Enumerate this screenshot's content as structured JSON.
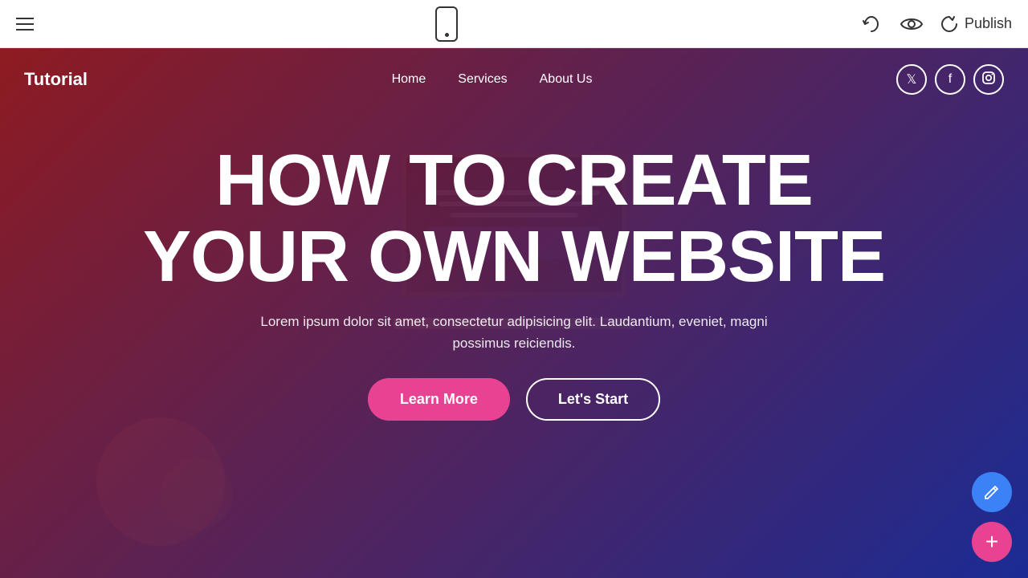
{
  "toolbar": {
    "publish_label": "Publish",
    "hamburger_label": "Menu"
  },
  "site": {
    "logo": "Tutorial",
    "nav": {
      "home": "Home",
      "services": "Services",
      "about_us": "About Us"
    },
    "social": {
      "twitter": "𝕏",
      "facebook": "f",
      "instagram": "in"
    },
    "hero": {
      "title_line1": "HOW TO CREATE",
      "title_line2": "YOUR OWN WEBSITE",
      "subtitle": "Lorem ipsum dolor sit amet, consectetur adipisicing elit. Laudantium, eveniet, magni possimus reiciendis.",
      "btn_learn_more": "Learn More",
      "btn_lets_start": "Let's Start"
    }
  },
  "icons": {
    "hamburger": "≡",
    "phone": "📱",
    "undo": "↩",
    "eye": "👁",
    "upload": "⬆",
    "pencil": "✏",
    "plus": "+"
  }
}
